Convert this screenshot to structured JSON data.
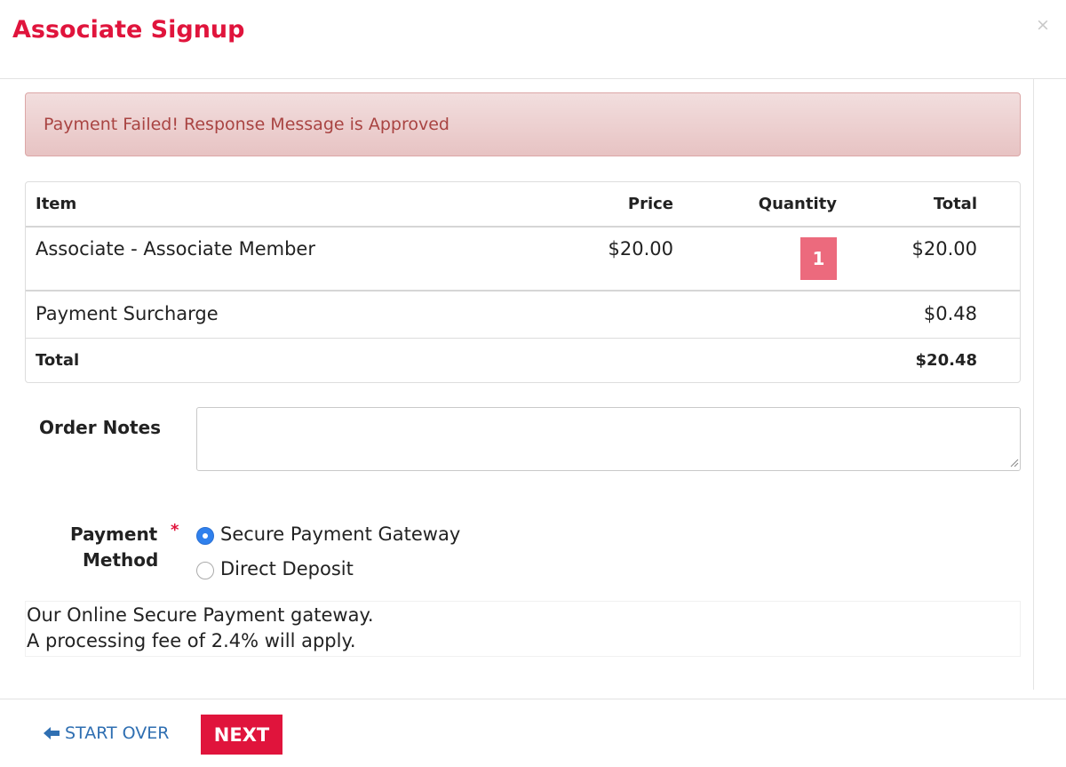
{
  "modal": {
    "title": "Associate Signup",
    "close_symbol": "×"
  },
  "alert": {
    "message": "Payment Failed! Response Message is Approved"
  },
  "cart": {
    "headers": {
      "item": "Item",
      "price": "Price",
      "quantity": "Quantity",
      "total": "Total"
    },
    "line_items": [
      {
        "item": "Associate - Associate Member",
        "price": "$20.00",
        "quantity": "1",
        "total": "$20.00"
      }
    ],
    "surcharge": {
      "label": "Payment Surcharge",
      "amount": "$0.48"
    },
    "grand_total": {
      "label": "Total",
      "amount": "$20.48"
    }
  },
  "order_notes": {
    "label": "Order Notes",
    "value": ""
  },
  "payment_method": {
    "label_line1": "Payment",
    "label_line2": "Method",
    "required_marker": "*",
    "selected": "Secure Payment Gateway",
    "options": [
      {
        "label": "Secure Payment Gateway",
        "checked": true
      },
      {
        "label": "Direct Deposit",
        "checked": false
      }
    ],
    "description_lines": [
      "Our Online Secure Payment gateway.",
      "A processing fee of 2.4% will apply."
    ]
  },
  "footer": {
    "start_over_label": "START OVER",
    "next_label": "NEXT"
  },
  "colors": {
    "brand_red": "#e0143c",
    "link_blue": "#2f6fb2",
    "quantity_badge": "#ec6a7d",
    "radio_selected": "#2f80ed"
  }
}
